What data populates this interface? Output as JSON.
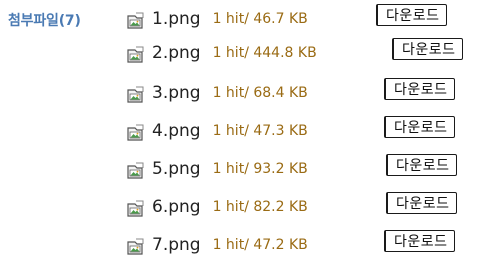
{
  "attachments": {
    "label": "첨부파일(7)",
    "icon": "image-file-icon",
    "files": [
      {
        "name": "1.png",
        "meta": "1 hit/ 46.7 KB",
        "download_label": "다운로드"
      },
      {
        "name": "2.png",
        "meta": "1 hit/ 444.8 KB",
        "download_label": "다운로드"
      },
      {
        "name": "3.png",
        "meta": "1 hit/ 68.4 KB",
        "download_label": "다운로드"
      },
      {
        "name": "4.png",
        "meta": "1 hit/ 47.3 KB",
        "download_label": "다운로드"
      },
      {
        "name": "5.png",
        "meta": "1 hit/ 93.2 KB",
        "download_label": "다운로드"
      },
      {
        "name": "6.png",
        "meta": "1 hit/ 82.2 KB",
        "download_label": "다운로드"
      },
      {
        "name": "7.png",
        "meta": "1 hit/ 47.2 KB",
        "download_label": "다운로드"
      }
    ]
  }
}
